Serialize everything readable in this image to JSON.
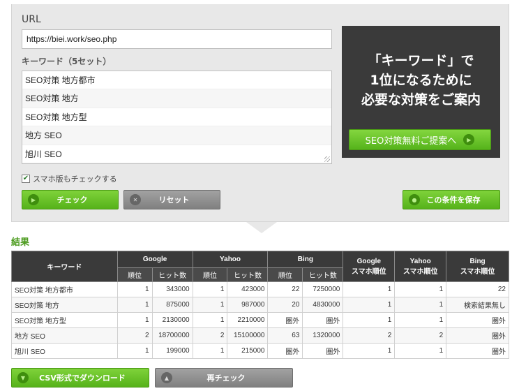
{
  "form": {
    "url_label": "URL",
    "url_value": "https://biei.work/seo.php",
    "keyword_label": "キーワード（5セット）",
    "keywords": [
      "SEO対策  地方都市",
      "SEO対策  地方",
      "SEO対策  地方型",
      "地方  SEO",
      "旭川  SEO"
    ],
    "mobile_check_label": "スマホ版もチェックする",
    "mobile_checked": true,
    "check_button": "チェック",
    "reset_button": "リセット",
    "save_button": "この条件を保存"
  },
  "promo": {
    "lines": [
      "「キーワード」で",
      "1位になるために",
      "必要な対策をご案内"
    ],
    "button": "SEO対策無料ご提案へ"
  },
  "results": {
    "title": "結果",
    "headers": {
      "keyword": "キーワード",
      "google": "Google",
      "yahoo": "Yahoo",
      "bing": "Bing",
      "google_sp_1": "Google",
      "google_sp_2": "スマホ順位",
      "yahoo_sp_1": "Yahoo",
      "yahoo_sp_2": "スマホ順位",
      "bing_sp_1": "Bing",
      "bing_sp_2": "スマホ順位",
      "rank": "順位",
      "hits": "ヒット数"
    },
    "rows": [
      [
        "SEO対策  地方都市",
        "1",
        "343000",
        "1",
        "423000",
        "22",
        "7250000",
        "1",
        "1",
        "22"
      ],
      [
        "SEO対策  地方",
        "1",
        "875000",
        "1",
        "987000",
        "20",
        "4830000",
        "1",
        "1",
        "検索結果無し"
      ],
      [
        "SEO対策  地方型",
        "1",
        "2130000",
        "1",
        "2210000",
        "圏外",
        "圏外",
        "1",
        "1",
        "圏外"
      ],
      [
        "地方  SEO",
        "2",
        "18700000",
        "2",
        "15100000",
        "63",
        "1320000",
        "2",
        "2",
        "圏外"
      ],
      [
        "旭川  SEO",
        "1",
        "199000",
        "1",
        "215000",
        "圏外",
        "圏外",
        "1",
        "1",
        "圏外"
      ]
    ],
    "csv_button": "CSV形式でダウンロード",
    "recheck_button": "再チェック"
  },
  "colors": {
    "accent": "#56b21a",
    "dark": "#3a3a3a",
    "title_green": "#4a9a1c"
  },
  "icons": {
    "go": "arrow-right-icon",
    "reset": "close-icon",
    "save": "save-icon",
    "download": "download-icon",
    "recheck": "refresh-icon"
  }
}
